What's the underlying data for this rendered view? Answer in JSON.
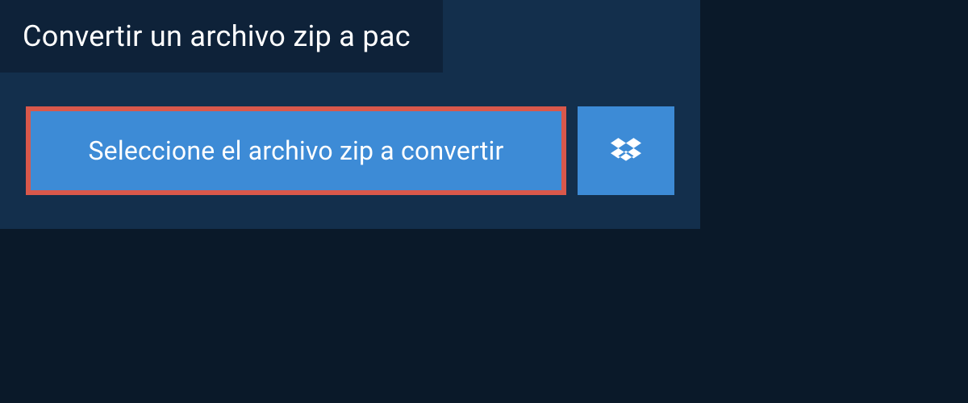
{
  "header": {
    "title": "Convertir un archivo zip a pac"
  },
  "actions": {
    "select_file_label": "Seleccione el archivo zip a convertir",
    "dropbox_icon_name": "dropbox-icon"
  },
  "colors": {
    "background": "#0a1929",
    "panel": "#132f4c",
    "tab": "#0e2239",
    "button": "#3d8bd6",
    "highlight_border": "#d9584b",
    "text": "#ffffff"
  }
}
